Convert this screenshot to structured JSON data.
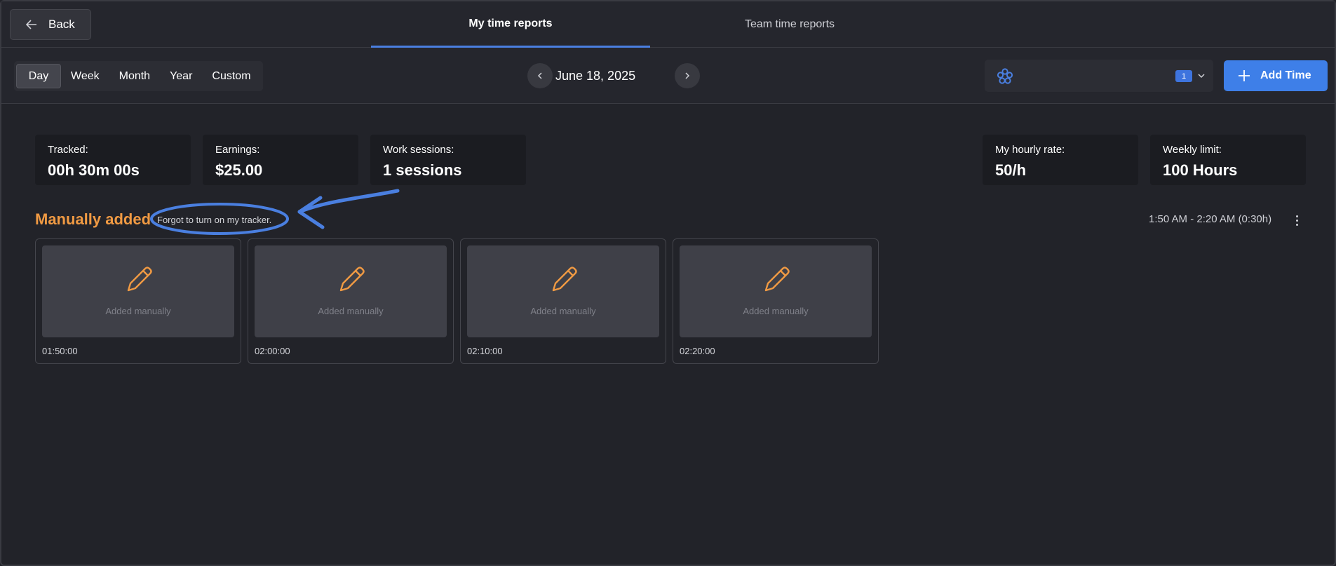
{
  "header": {
    "back_label": "Back",
    "tabs": [
      {
        "label": "My time reports",
        "active": true
      },
      {
        "label": "Team time reports",
        "active": false
      }
    ]
  },
  "toolbar": {
    "ranges": [
      "Day",
      "Week",
      "Month",
      "Year",
      "Custom"
    ],
    "active_range": "Day",
    "date": "June 18, 2025",
    "team_badge": "1",
    "add_label": "Add Time"
  },
  "stats": [
    {
      "label": "Tracked:",
      "value": "00h 30m 00s"
    },
    {
      "label": "Earnings:",
      "value": "$25.00"
    },
    {
      "label": "Work sessions:",
      "value": "1 sessions"
    },
    {
      "label": "My hourly rate:",
      "value": "50/h"
    },
    {
      "label": "Weekly limit:",
      "value": "100 Hours"
    }
  ],
  "session": {
    "title": "Manually added",
    "note": "Forgot to turn on my tracker.",
    "time_range": "1:50 AM - 2:20 AM (0:30h)",
    "cards": [
      {
        "caption": "Added manually",
        "time": "01:50:00"
      },
      {
        "caption": "Added manually",
        "time": "02:00:00"
      },
      {
        "caption": "Added manually",
        "time": "02:10:00"
      },
      {
        "caption": "Added manually",
        "time": "02:20:00"
      }
    ]
  },
  "colors": {
    "accent_blue": "#3e7fe8",
    "orange": "#f09a43",
    "background": "#222329",
    "annotation": "#4a7fe0"
  },
  "icons": [
    "arrow-left-icon",
    "chevron-left-icon",
    "chevron-right-icon",
    "team-logo-icon",
    "chevron-down-icon",
    "plus-icon",
    "pencil-icon",
    "kebab-menu-icon"
  ]
}
